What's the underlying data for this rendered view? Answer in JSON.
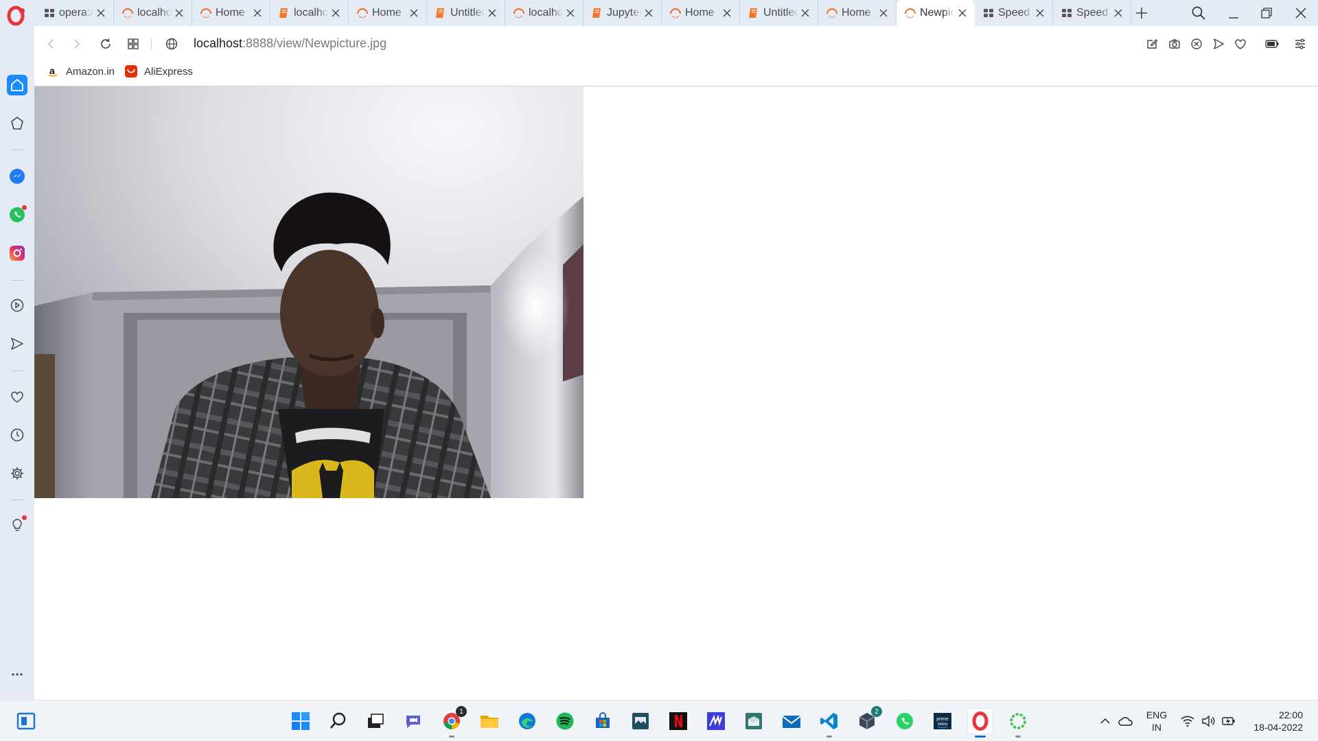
{
  "browser": {
    "url_host": "localhost",
    "url_path": ":8888/view/Newpicture.jpg",
    "tabs": [
      {
        "title": "opera://",
        "icon": "speed-dial-icon",
        "active": false
      },
      {
        "title": "localhost",
        "icon": "opera-icon",
        "active": false
      },
      {
        "title": "Home",
        "icon": "opera-icon",
        "active": false
      },
      {
        "title": "localhost",
        "icon": "notebook-icon",
        "active": false
      },
      {
        "title": "Home",
        "icon": "opera-icon",
        "active": false
      },
      {
        "title": "Untitled",
        "icon": "notebook-icon",
        "active": false
      },
      {
        "title": "localhost",
        "icon": "opera-icon",
        "active": false
      },
      {
        "title": "Jupyter",
        "icon": "notebook-icon",
        "active": false
      },
      {
        "title": "Home",
        "icon": "opera-icon",
        "active": false
      },
      {
        "title": "Untitled",
        "icon": "notebook-icon",
        "active": false
      },
      {
        "title": "Home",
        "icon": "opera-icon",
        "active": false
      },
      {
        "title": "Newpicture",
        "icon": "opera-icon",
        "active": true
      },
      {
        "title": "Speed Dial",
        "icon": "speed-dial-icon",
        "active": false
      },
      {
        "title": "Speed Dial",
        "icon": "speed-dial-icon",
        "active": false
      }
    ],
    "bookmarks": [
      {
        "label": "Amazon.in",
        "icon": "amazon-icon"
      },
      {
        "label": "AliExpress",
        "icon": "aliexpress-icon"
      }
    ]
  },
  "taskbar": {
    "lang_line1": "ENG",
    "lang_line2": "IN",
    "time": "22:00",
    "date": "18-04-2022",
    "chrome_badge": "1",
    "app_badge": "2"
  },
  "colors": {
    "tabstrip_bg": "#e4ebf4",
    "opera_red": "#e8343b",
    "accent_blue": "#1a8cff",
    "taskbar_bg": "#f0f3f8"
  }
}
